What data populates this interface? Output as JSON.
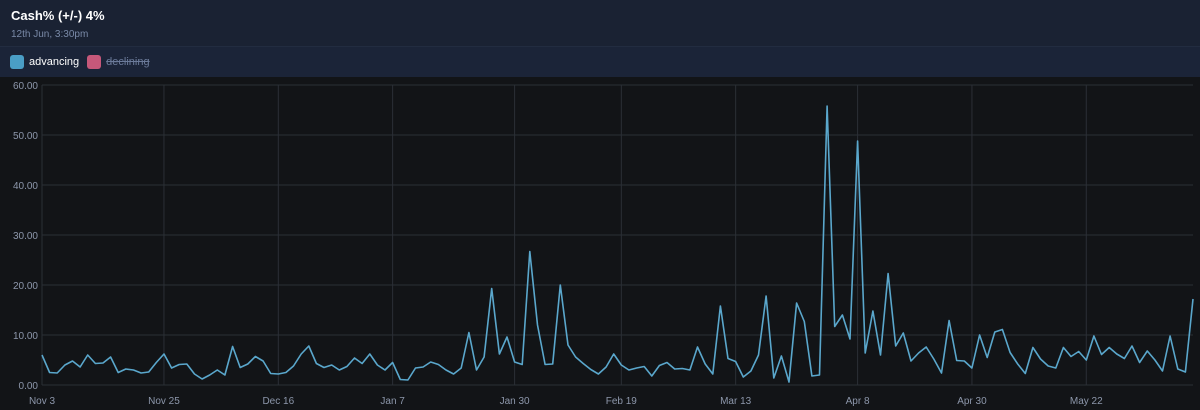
{
  "header": {
    "title": "Cash% (+/-) 4%",
    "subtitle": "12th Jun, 3:30pm"
  },
  "legend": [
    {
      "label": "advancing",
      "color": "#4a9ec6",
      "active": true
    },
    {
      "label": "declining",
      "color": "#c6587a",
      "active": false
    }
  ],
  "chart_data": {
    "type": "line",
    "ylim": [
      0,
      60
    ],
    "y_ticks": [
      "60.00",
      "50.00",
      "40.00",
      "30.00",
      "20.00",
      "10.00",
      "0.00"
    ],
    "x_ticks": [
      {
        "label": "Nov 3",
        "index": 0
      },
      {
        "label": "Nov 25",
        "index": 16
      },
      {
        "label": "Dec 16",
        "index": 31
      },
      {
        "label": "Jan 7",
        "index": 46
      },
      {
        "label": "Jan 30",
        "index": 62
      },
      {
        "label": "Feb 19",
        "index": 76
      },
      {
        "label": "Mar 13",
        "index": 91
      },
      {
        "label": "Apr 8",
        "index": 107
      },
      {
        "label": "Apr 30",
        "index": 122
      },
      {
        "label": "May 22",
        "index": 137
      }
    ],
    "grid": true,
    "series": [
      {
        "name": "advancing",
        "color": "#5aa7cc",
        "values": [
          6.0,
          2.5,
          2.4,
          4.0,
          4.8,
          3.6,
          6.0,
          4.3,
          4.4,
          5.6,
          2.5,
          3.2,
          3.0,
          2.4,
          2.6,
          4.5,
          6.2,
          3.4,
          4.1,
          4.2,
          2.2,
          1.2,
          2.0,
          3.0,
          2.0,
          7.7,
          3.5,
          4.2,
          5.7,
          4.8,
          2.3,
          2.2,
          2.5,
          3.8,
          6.2,
          7.8,
          4.3,
          3.5,
          4.0,
          3.0,
          3.7,
          5.4,
          4.3,
          6.2,
          4.0,
          3.0,
          4.5,
          1.1,
          1.0,
          3.4,
          3.6,
          4.6,
          4.1,
          3.0,
          2.2,
          3.4,
          10.5,
          3.0,
          5.6,
          19.3,
          6.2,
          9.6,
          4.6,
          4.1,
          26.7,
          12.0,
          4.1,
          4.2,
          20.0,
          8.0,
          5.6,
          4.3,
          3.1,
          2.2,
          3.6,
          6.2,
          4.0,
          3.0,
          3.4,
          3.7,
          1.8,
          3.9,
          4.5,
          3.2,
          3.3,
          3.0,
          7.6,
          4.2,
          2.2,
          15.8,
          5.3,
          4.7,
          1.6,
          2.8,
          6.0,
          17.8,
          1.4,
          5.8,
          0.6,
          16.4,
          12.7,
          1.8,
          2.0,
          55.8,
          11.7,
          14.0,
          9.2,
          48.8,
          6.4,
          14.8,
          6.0,
          22.3,
          7.8,
          10.4,
          4.8,
          6.4,
          7.6,
          5.2,
          2.4,
          12.9,
          4.9,
          4.8,
          3.4,
          10.0,
          5.5,
          10.6,
          11.1,
          6.5,
          4.2,
          2.3,
          7.5,
          5.2,
          3.8,
          3.4,
          7.5,
          5.7,
          6.7,
          5.0,
          9.8,
          6.1,
          7.5,
          6.2,
          5.3,
          7.8,
          4.5,
          6.8,
          5.0,
          2.8,
          9.8,
          3.2,
          2.6,
          17.2
        ]
      }
    ]
  }
}
